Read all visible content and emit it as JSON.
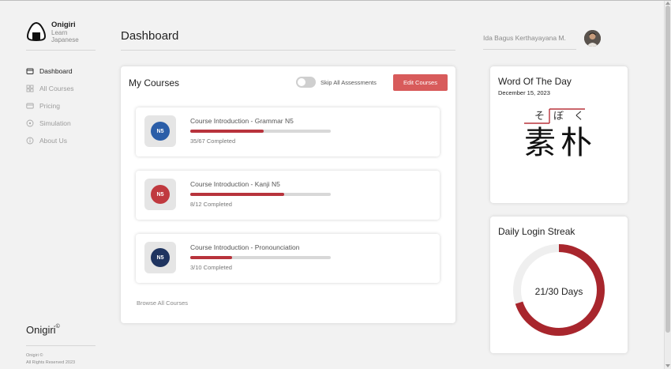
{
  "brand": {
    "name": "Onigiri",
    "subtitle_line1": "Learn",
    "subtitle_line2": "Japanese"
  },
  "nav": [
    {
      "label": "Dashboard",
      "icon": "wallet-icon",
      "active": true
    },
    {
      "label": "All Courses",
      "icon": "grid-icon",
      "active": false
    },
    {
      "label": "Pricing",
      "icon": "card-icon",
      "active": false
    },
    {
      "label": "Simulation",
      "icon": "target-icon",
      "active": false
    },
    {
      "label": "About Us",
      "icon": "info-icon",
      "active": false
    }
  ],
  "footer": {
    "brand": "Onigiri",
    "trademark": "©",
    "copy_line1": "Onigiri ©",
    "copy_line2": "All Rights Reserved 2023"
  },
  "header": {
    "title": "Dashboard",
    "user_name": "Ida Bagus Kerthayayana M."
  },
  "courses": {
    "title": "My Courses",
    "skip_label": "Skip All Assessments",
    "skip_enabled": false,
    "edit_label": "Edit Courses",
    "browse_label": "Browse All Courses",
    "items": [
      {
        "badge": "N5",
        "badge_color": "#2b5ea8",
        "name": "Course Introduction - Grammar N5",
        "status": "35/67 Completed",
        "progress": 0.5224
      },
      {
        "badge": "N5",
        "badge_color": "#c0393f",
        "name": "Course Introduction - Kanji N5",
        "status": "8/12 Completed",
        "progress": 0.6667
      },
      {
        "badge": "N5",
        "badge_color": "#1f3460",
        "name": "Course Introduction - Pronounciation",
        "status": "3/10 Completed",
        "progress": 0.3
      }
    ]
  },
  "word_of_day": {
    "title": "Word Of The Day",
    "date": "December 15, 2023",
    "furigana": [
      "そ",
      "ぼ",
      "く"
    ],
    "kanji": [
      "素",
      "朴"
    ]
  },
  "streak": {
    "title": "Daily Login Streak",
    "label": "21/30 Days",
    "current": 21,
    "total": 30,
    "ring_color": "#a8262d",
    "track_color": "#efefef"
  },
  "colors": {
    "accent": "#d85b5b",
    "progress": "#b8333c"
  }
}
